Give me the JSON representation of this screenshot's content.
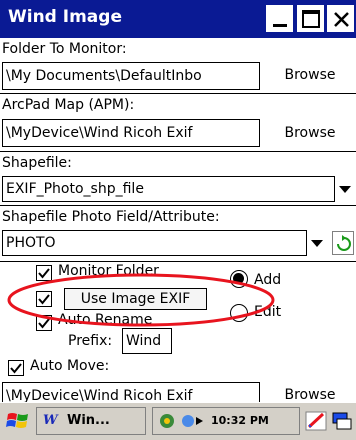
{
  "window": {
    "title": "Wind Image",
    "minimize_glyph": "_",
    "maximize_glyph": "□",
    "close_glyph": "×"
  },
  "folder": {
    "label": "Folder To Monitor:",
    "value": "\\My Documents\\DefaultInbo",
    "browse_label": "Browse"
  },
  "arcpad": {
    "label": "ArcPad Map (APM):",
    "value": "\\MyDevice\\Wind Ricoh Exif",
    "browse_label": "Browse"
  },
  "shapefile": {
    "label": "Shapefile:",
    "value": "EXIF_Photo_shp_file"
  },
  "photo_field": {
    "label": "Shapefile Photo Field/Attribute:",
    "value": "PHOTO"
  },
  "options": {
    "monitor_folder": {
      "label": "Monitor Folder",
      "checked": true
    },
    "use_image_exif": {
      "label": "Use Image EXIF",
      "checked": true
    },
    "auto_rename": {
      "label": "Auto Rename",
      "checked": true
    },
    "prefix_label": "Prefix:",
    "prefix_value": "Wind",
    "auto_move": {
      "label": "Auto Move:",
      "checked": true
    }
  },
  "mode": {
    "add_label": "Add",
    "edit_label": "Edit",
    "selected": "Add"
  },
  "move_target": {
    "value": "\\MyDevice\\Wind Ricoh Exif",
    "browse_label": "Browse"
  },
  "taskbar": {
    "app_label": "Win...",
    "clock": "10:32 PM"
  },
  "colors": {
    "titlebar": "#0a1a94",
    "highlight": "#e8141e",
    "taskbar": "#d4d0c8"
  }
}
